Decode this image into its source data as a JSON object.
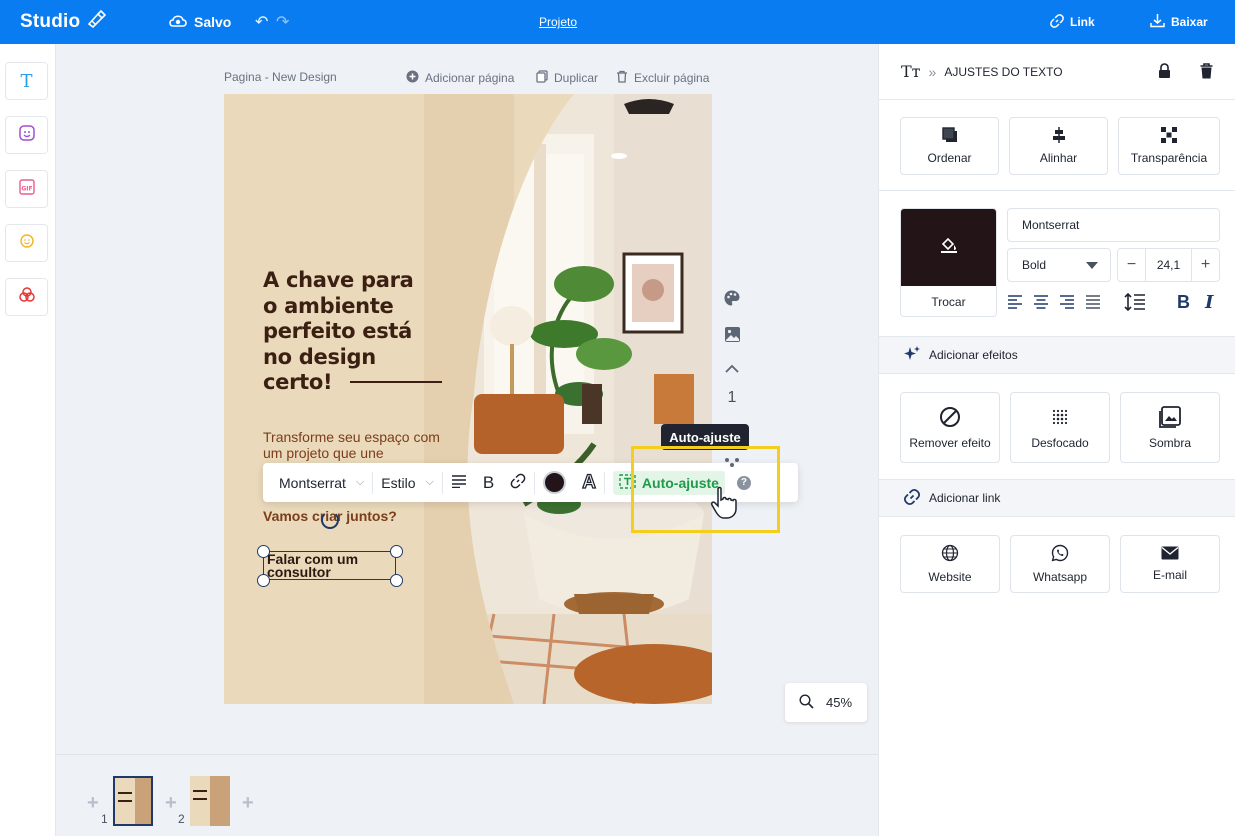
{
  "topbar": {
    "logo": "Studio",
    "save_status": "Salvo",
    "project_link": "Projeto",
    "link_label": "Link",
    "download_label": "Baixar"
  },
  "left_rail": {
    "items": [
      {
        "icon": "text-icon"
      },
      {
        "icon": "sticker-icon"
      },
      {
        "icon": "gif-icon"
      },
      {
        "icon": "emoji-icon"
      },
      {
        "icon": "shapes-icon"
      }
    ]
  },
  "page_header": {
    "title": "Pagina - New Design",
    "add_page": "Adicionar página",
    "duplicate": "Duplicar",
    "delete_page": "Excluir página"
  },
  "design": {
    "headline": [
      "A chave para",
      "o ambiente",
      "perfeito está",
      "no design",
      "certo!"
    ],
    "subtext": "Transforme seu espaço com um projeto que une",
    "cta_question": "Vamos criar juntos?",
    "button_text": [
      "Falar com um",
      "consultor"
    ]
  },
  "text_toolbar": {
    "font": "Montserrat",
    "style": "Estilo",
    "auto_adjust": "Auto-ajuste",
    "text_color": "#221418",
    "tooltip": "Auto-ajuste"
  },
  "side_tools": {
    "page_number": "1"
  },
  "zoom": {
    "value": "45%"
  },
  "thumbnails": {
    "pages": [
      {
        "number": "1",
        "active": true
      },
      {
        "number": "2",
        "active": false
      }
    ]
  },
  "right_panel": {
    "header_title": "AJUSTES DO TEXTO",
    "actions": [
      {
        "label": "Ordenar",
        "icon": "layers-icon"
      },
      {
        "label": "Alinhar",
        "icon": "align-icon"
      },
      {
        "label": "Transparência",
        "icon": "transparency-icon"
      }
    ],
    "color_swatch": "#231418",
    "swap_label": "Trocar",
    "font_name": "Montserrat",
    "font_weight": "Bold",
    "font_size": "24,1",
    "effects_section": "Adicionar efeitos",
    "effects": [
      {
        "label": "Remover efeito",
        "icon": "no-effect-icon"
      },
      {
        "label": "Desfocado",
        "icon": "blur-icon"
      },
      {
        "label": "Sombra",
        "icon": "shadow-icon"
      }
    ],
    "link_section": "Adicionar link",
    "links": [
      {
        "label": "Website",
        "icon": "globe-icon"
      },
      {
        "label": "Whatsapp",
        "icon": "whatsapp-icon"
      },
      {
        "label": "E-mail",
        "icon": "mail-icon"
      }
    ]
  },
  "colors": {
    "brand": "#0a7cf2",
    "accent_green": "#1e9a4a",
    "highlight": "#f2cf1f"
  }
}
